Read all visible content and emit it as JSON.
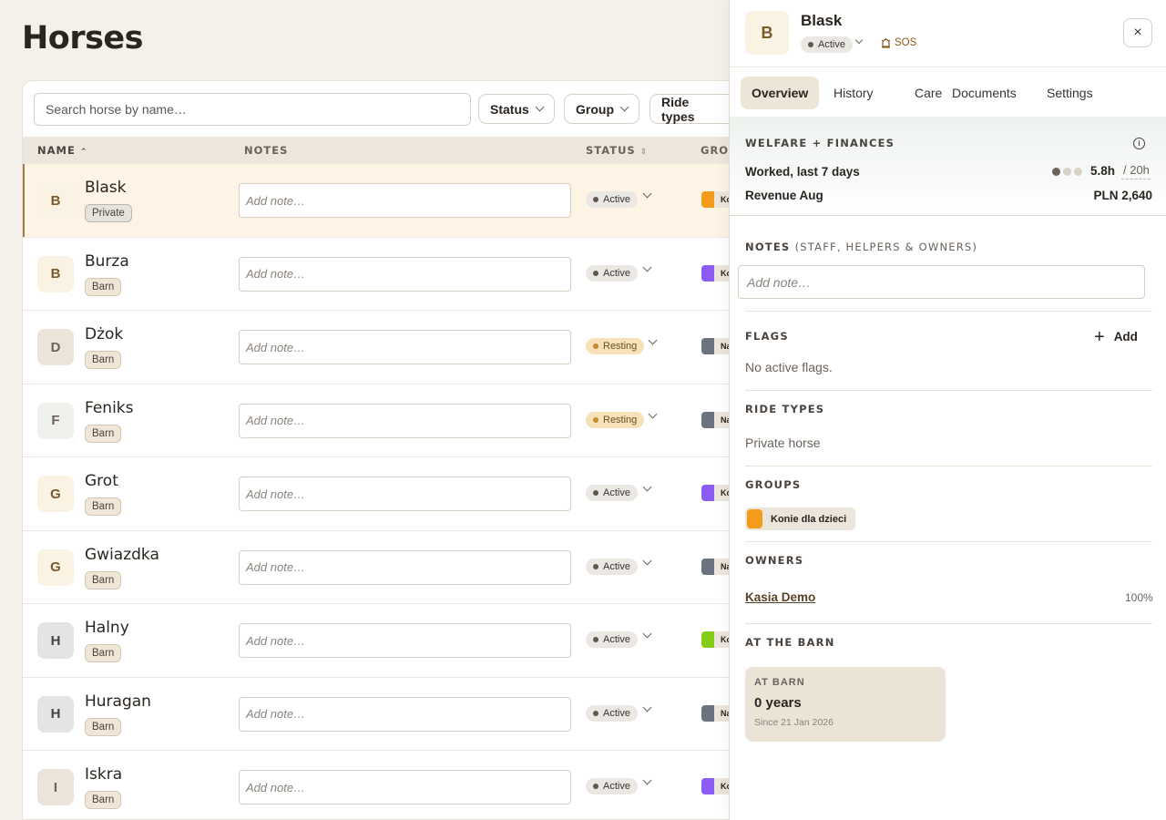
{
  "page": {
    "title": "Horses"
  },
  "toolbar": {
    "search_placeholder": "Search horse by name…",
    "filters": [
      "Status",
      "Group",
      "Ride types"
    ]
  },
  "table": {
    "headers": {
      "name": "NAME",
      "notes": "NOTES",
      "status": "STATUS",
      "group": "GROU"
    },
    "note_placeholder": "Add note…",
    "rows": [
      {
        "initial": "B",
        "name": "Blask",
        "badge": "Private",
        "status": "Active",
        "group_color": "#f59b1c",
        "group_abbr": "Ko",
        "avatar_bg": "#faf3e4",
        "avatar_fg": "#7a5a2a"
      },
      {
        "initial": "B",
        "name": "Burza",
        "badge": "Barn",
        "status": "Active",
        "group_color": "#8b5cf6",
        "group_abbr": "Ko",
        "avatar_bg": "#faf3e4",
        "avatar_fg": "#7a5a2a"
      },
      {
        "initial": "D",
        "name": "Dżok",
        "badge": "Barn",
        "status": "Resting",
        "group_color": "#6b7280",
        "group_abbr": "Na",
        "avatar_bg": "#ebe4d8",
        "avatar_fg": "#6a625b"
      },
      {
        "initial": "F",
        "name": "Feniks",
        "badge": "Barn",
        "status": "Resting",
        "group_color": "#6b7280",
        "group_abbr": "Na",
        "avatar_bg": "#eef0ec",
        "avatar_fg": "#6a625b"
      },
      {
        "initial": "G",
        "name": "Grot",
        "badge": "Barn",
        "status": "Active",
        "group_color": "#8b5cf6",
        "group_abbr": "Ko",
        "avatar_bg": "#faf3e4",
        "avatar_fg": "#7a5a2a"
      },
      {
        "initial": "G",
        "name": "Gwiazdka",
        "badge": "Barn",
        "status": "Active",
        "group_color": "#6b7280",
        "group_abbr": "Na",
        "avatar_bg": "#faf3e4",
        "avatar_fg": "#7a5a2a"
      },
      {
        "initial": "H",
        "name": "Halny",
        "badge": "Barn",
        "status": "Active",
        "group_color": "#84cc16",
        "group_abbr": "Ko",
        "avatar_bg": "#e2e5e3",
        "avatar_fg": "#4a433d"
      },
      {
        "initial": "H",
        "name": "Huragan",
        "badge": "Barn",
        "status": "Active",
        "group_color": "#6b7280",
        "group_abbr": "Na",
        "avatar_bg": "#e2e5e3",
        "avatar_fg": "#4a433d"
      },
      {
        "initial": "I",
        "name": "Iskra",
        "badge": "Barn",
        "status": "Active",
        "group_color": "#8b5cf6",
        "group_abbr": "Ko",
        "avatar_bg": "#ebe4d8",
        "avatar_fg": "#6a625b"
      }
    ]
  },
  "panel": {
    "initial": "B",
    "name": "Blask",
    "status": "Active",
    "sos": "SOS",
    "close_icon": "×",
    "tabs": [
      "Overview",
      "History",
      "Care",
      "Documents",
      "Settings"
    ],
    "welfare": {
      "title": "WELFARE + FINANCES",
      "worked_label": "Worked, last 7 days",
      "worked_value": "5.8h",
      "worked_target": "/ 20h",
      "workload_dots": 3,
      "workload_filled": 1,
      "revenue_label": "Revenue Aug",
      "revenue_value": "PLN 2,640"
    },
    "notes": {
      "title": "NOTES",
      "subtitle": "(STAFF, HELPERS & OWNERS)",
      "placeholder": "Add note…"
    },
    "flags": {
      "title": "FLAGS",
      "add_label": "Add",
      "empty": "No active flags."
    },
    "ride_types": {
      "title": "RIDE TYPES",
      "value": "Private horse"
    },
    "groups": {
      "title": "GROUPS",
      "items": [
        "Konie dla dzieci"
      ],
      "color": "#f59b1c"
    },
    "owners": {
      "title": "OWNERS",
      "items": [
        {
          "name": "Kasia Demo",
          "share": "100%"
        }
      ]
    },
    "at_barn": {
      "title": "AT THE BARN",
      "card_label": "AT BARN",
      "value": "0 years",
      "since": "Since 21 Jan 2026"
    }
  }
}
